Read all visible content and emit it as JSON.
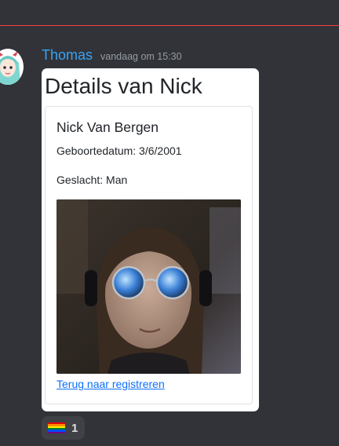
{
  "message": {
    "author": "Thomas",
    "timestamp": "vandaag om 15:30"
  },
  "embed": {
    "title": "Details van Nick",
    "person": {
      "name": "Nick Van Bergen",
      "birthdate": "Geboortedatum: 3/6/2001",
      "gender": "Geslacht: Man"
    },
    "back_link": "Terug naar registreren"
  },
  "reaction": {
    "emoji_icon": "rainbow-flag-icon",
    "count": "1",
    "flag_colors": [
      "#e40303",
      "#ff8c00",
      "#ffed00",
      "#008026",
      "#004dff",
      "#750787"
    ]
  },
  "colors": {
    "background": "#313338",
    "username": "#3aa3f4",
    "link": "#0d6efd",
    "divider": "#f23f43"
  }
}
